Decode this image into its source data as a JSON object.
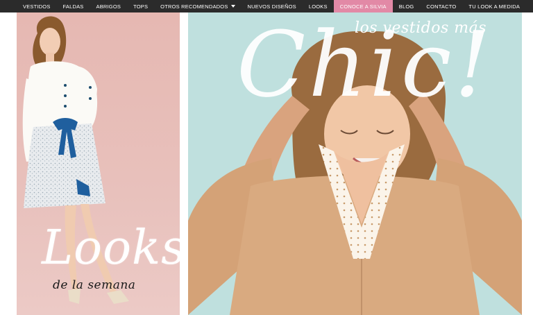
{
  "nav": {
    "items": [
      {
        "label": "VESTIDOS"
      },
      {
        "label": "FALDAS"
      },
      {
        "label": "ABRIGOS"
      },
      {
        "label": "TOPS"
      },
      {
        "label": "OTROS RECOMENDADOS",
        "has_dropdown": true
      },
      {
        "label": "NUEVOS DISEÑOS"
      },
      {
        "label": "LOOKS"
      },
      {
        "label": "CONOCE A SILVIA",
        "active": true
      },
      {
        "label": "BLOG"
      },
      {
        "label": "CONTACTO"
      },
      {
        "label": "TU LOOK A MEDIDA"
      }
    ],
    "active_color": "#e289a6",
    "background": "#2b2b2b"
  },
  "banner_left": {
    "title": "Looks",
    "subtitle": "de la semana",
    "background": "#e8c1bc"
  },
  "banner_right": {
    "title": "Chic!",
    "subtitle": "los vestidos más",
    "background": "#bfe0de"
  }
}
